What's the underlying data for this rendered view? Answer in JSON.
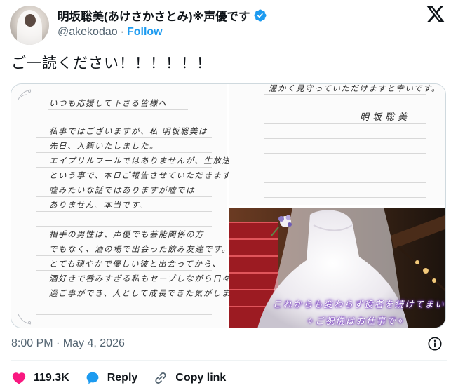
{
  "author": {
    "display_name": "明坂聡美(あけさかさとみ)※声優です",
    "handle": "@akekodao",
    "separator": "·",
    "follow_label": "Follow"
  },
  "tweet": {
    "text": "ご一読ください！！！！！！"
  },
  "letter_left": {
    "lines": [
      "いつも応援して下さる皆様へ",
      "私事ではございますが、私 明坂聡美は",
      "先日、入籍いたしました。",
      "エイプリルフールではありませんが、生放送",
      "という事で、本日ご報告させていただきます。",
      "嘘みたいな話ではありますが嘘では",
      "ありません。本当です。",
      "相手の男性は、声優でも芸能関係の方",
      "でもなく、酒の場で出会った飲み友達です。",
      "とても穏やかで優しい彼と出会ってから、",
      "酒好きで呑みすぎる私もセーブしながら日々",
      "過ご事ができ、人として成長できた気がします。"
    ]
  },
  "letter_right": {
    "top_line": "温かく見守っていただけますと幸いです。",
    "signature": "明坂聡美"
  },
  "photo_caption": {
    "line1": "これからも変わらず役者を続けてまいります",
    "line2": "✧ご祝儀はお仕事で✧"
  },
  "meta": {
    "timestamp": "8:00 PM · May 4, 2026"
  },
  "actions": {
    "likes": "119.3K",
    "reply_label": "Reply",
    "copy_link_label": "Copy link"
  },
  "colors": {
    "accent": "#1d9bf0",
    "like": "#f91880",
    "muted": "#536471"
  }
}
